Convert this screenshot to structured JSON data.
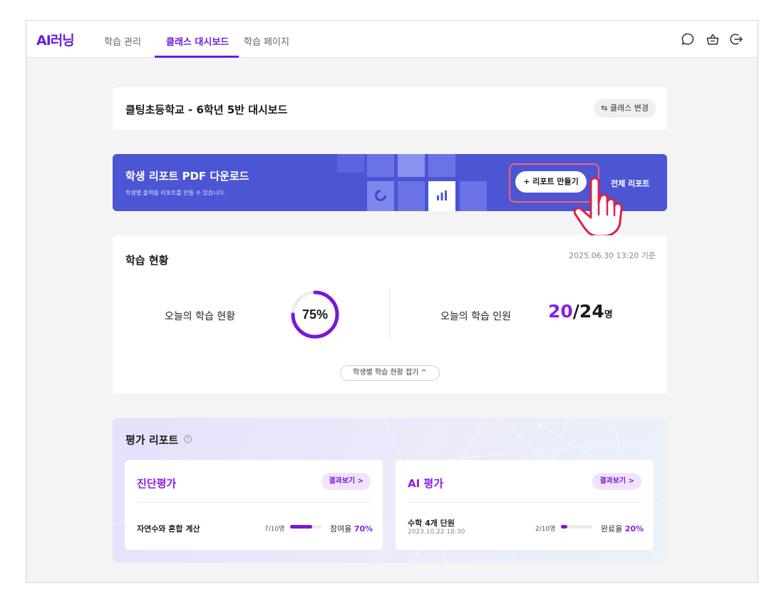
{
  "nav": {
    "logo": "AI러닝",
    "tabs": [
      {
        "label": "학습 관리"
      },
      {
        "label": "클래스 대시보드"
      },
      {
        "label": "학습 페이지"
      }
    ],
    "icons": [
      "chat-icon",
      "basket-icon",
      "logout-icon"
    ]
  },
  "school": {
    "title": "클팅초등학교 - 6학년 5반 대시보드",
    "change_label": "⇆ 클래스 변경"
  },
  "banner": {
    "title": "학생 리포트 PDF 다운로드",
    "subtitle": "학생별 출력용 리포트를 만들 수 있습니다.",
    "create_label": "+ 리포트 만들기",
    "all_label": "전체 리포트"
  },
  "status": {
    "title": "학습 현황",
    "timestamp": "2025.06.30 13:20 기준",
    "today_label": "오늘의 학습 현황",
    "progress_text": "75%",
    "progress_value": 0.75,
    "people_label": "오늘의 학습 인원",
    "current": "20",
    "total": "/24",
    "unit": "명",
    "collapse_label": "학생별 학습 현황 접기 ^"
  },
  "eval": {
    "title": "평가 리포트",
    "help": "?",
    "cards": [
      {
        "title": "진단평가",
        "result_label": "결과보기 >",
        "item": "자연수와 혼합 계산",
        "date": "",
        "fraction": "7/10명",
        "fill": 0.7,
        "rate_label": "참여율",
        "rate_value": "70%"
      },
      {
        "title": "AI 평가",
        "result_label": "결과보기 >",
        "item": "수학 4개 단원",
        "date": "2023.10.22 18:30",
        "fraction": "2/10명",
        "fill": 0.2,
        "rate_label": "완료율",
        "rate_value": "20%"
      }
    ]
  },
  "colors": {
    "brand": "#6a1fd9",
    "accent": "#8a1fe6",
    "banner": "#4c55d4",
    "highlight": "#ff5d6c"
  }
}
